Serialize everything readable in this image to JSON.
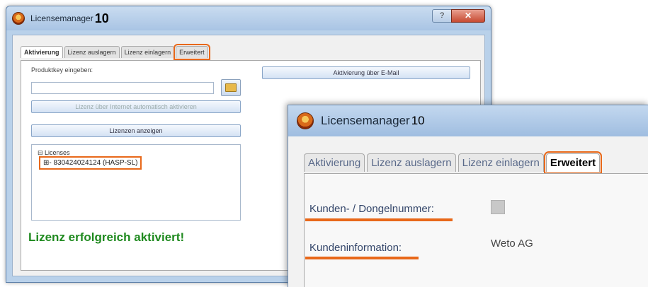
{
  "back_window": {
    "title": "Licensemanager",
    "version": "10",
    "help_label": "?",
    "close_label": "✕",
    "tabs": [
      "Aktivierung",
      "Lizenz auslagern",
      "Lizenz einlagern",
      "Erweitert"
    ],
    "productkey_label": "Produktkey eingeben:",
    "email_button": "Aktivierung über E-Mail",
    "activate_button": "Lizenz über Internet automatisch aktivieren",
    "show_licenses_button": "Lizenzen anzeigen",
    "tree_root": "⊟ Licenses",
    "tree_item": "⊞- 830424024124 (HASP-SL)",
    "success_message": "Lizenz erfolgreich aktiviert!"
  },
  "front_window": {
    "title": "Licensemanager",
    "version": "10",
    "tabs": [
      "Aktivierung",
      "Lizenz auslagern",
      "Lizenz einlagern",
      "Erweitert"
    ],
    "dongle_label": "Kunden- / Dongelnummer:",
    "info_label": "Kundeninformation:",
    "info_value": "Weto AG"
  },
  "colors": {
    "highlight": "#e8681a",
    "success_green": "#1f8a1f",
    "title_gradient": "#a9c4e4"
  }
}
